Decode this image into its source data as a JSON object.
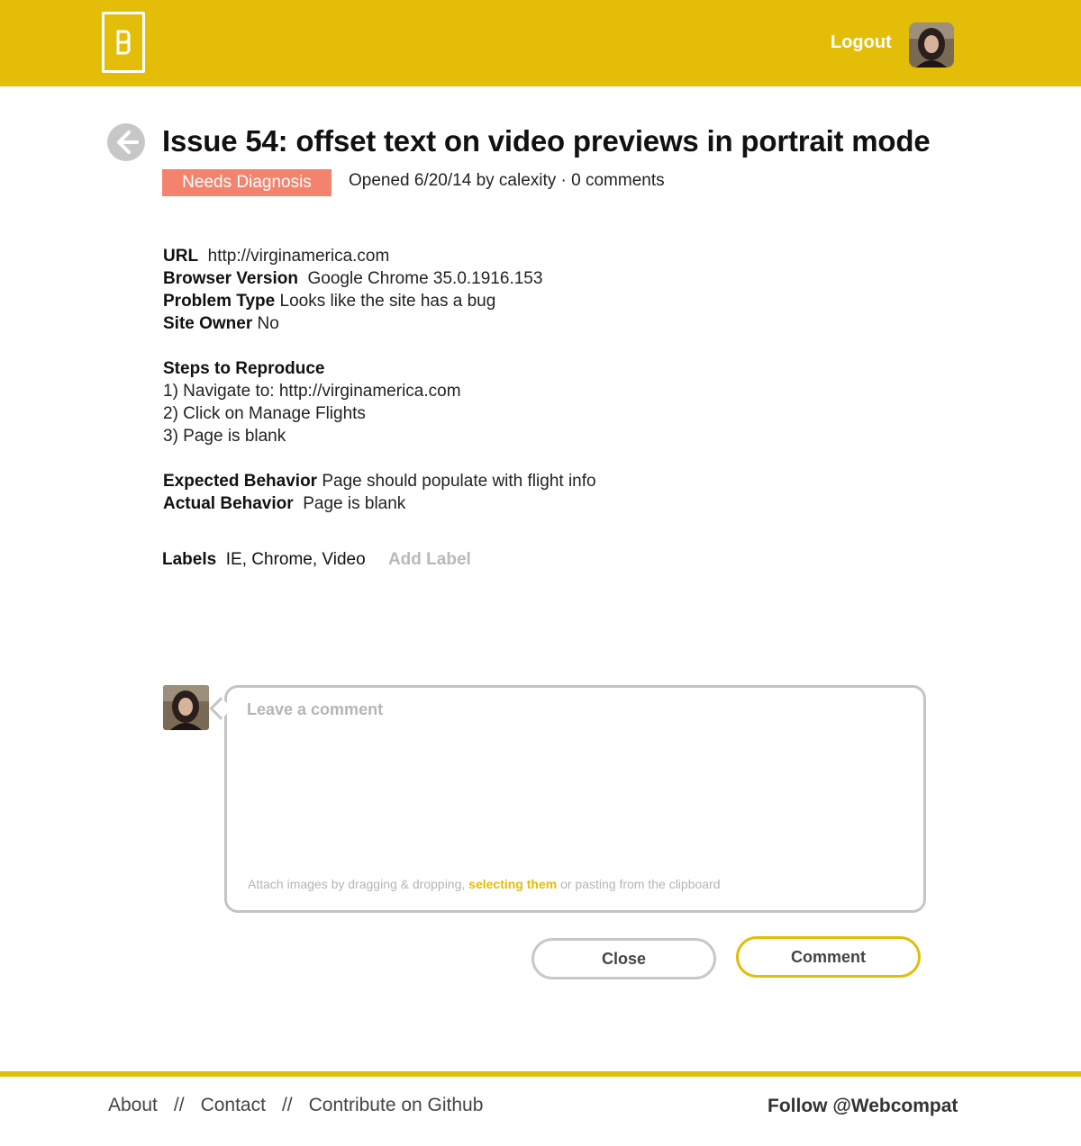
{
  "header": {
    "logout_label": "Logout"
  },
  "issue": {
    "title": "Issue 54: offset text on video previews in portrait mode",
    "status_badge": "Needs Diagnosis",
    "meta": "Opened 6/20/14 by calexity · 0 comments"
  },
  "details": {
    "url_label": "URL",
    "url_value": "http://virginamerica.com",
    "browser_label": "Browser Version",
    "browser_value": "Google Chrome 35.0.1916.153",
    "problem_label": "Problem Type",
    "problem_value": "Looks like the site has a bug",
    "owner_label": "Site Owner",
    "owner_value": "No",
    "steps_label": "Steps to Reproduce",
    "steps": [
      "1) Navigate to: http://virginamerica.com",
      "2) Click on Manage Flights",
      "3) Page is blank"
    ],
    "expected_label": "Expected Behavior",
    "expected_value": "Page should populate with flight info",
    "actual_label": "Actual Behavior",
    "actual_value": "Page is blank"
  },
  "labels": {
    "heading": "Labels",
    "values": "IE, Chrome, Video",
    "add_label": "Add Label"
  },
  "comment": {
    "placeholder": "Leave a comment",
    "attach_prefix": "Attach images by dragging & dropping, ",
    "attach_link": "selecting them",
    "attach_suffix": " or pasting from the clipboard",
    "close_label": "Close",
    "comment_label": "Comment"
  },
  "footer": {
    "about": "About",
    "contact": "Contact",
    "github": "Contribute on Github",
    "separator": "//",
    "follow": "Follow @Webcompat"
  },
  "colors": {
    "brand_yellow": "#e4bd08",
    "badge_salmon": "#f4836e",
    "muted_gray": "#b5b5b5"
  }
}
